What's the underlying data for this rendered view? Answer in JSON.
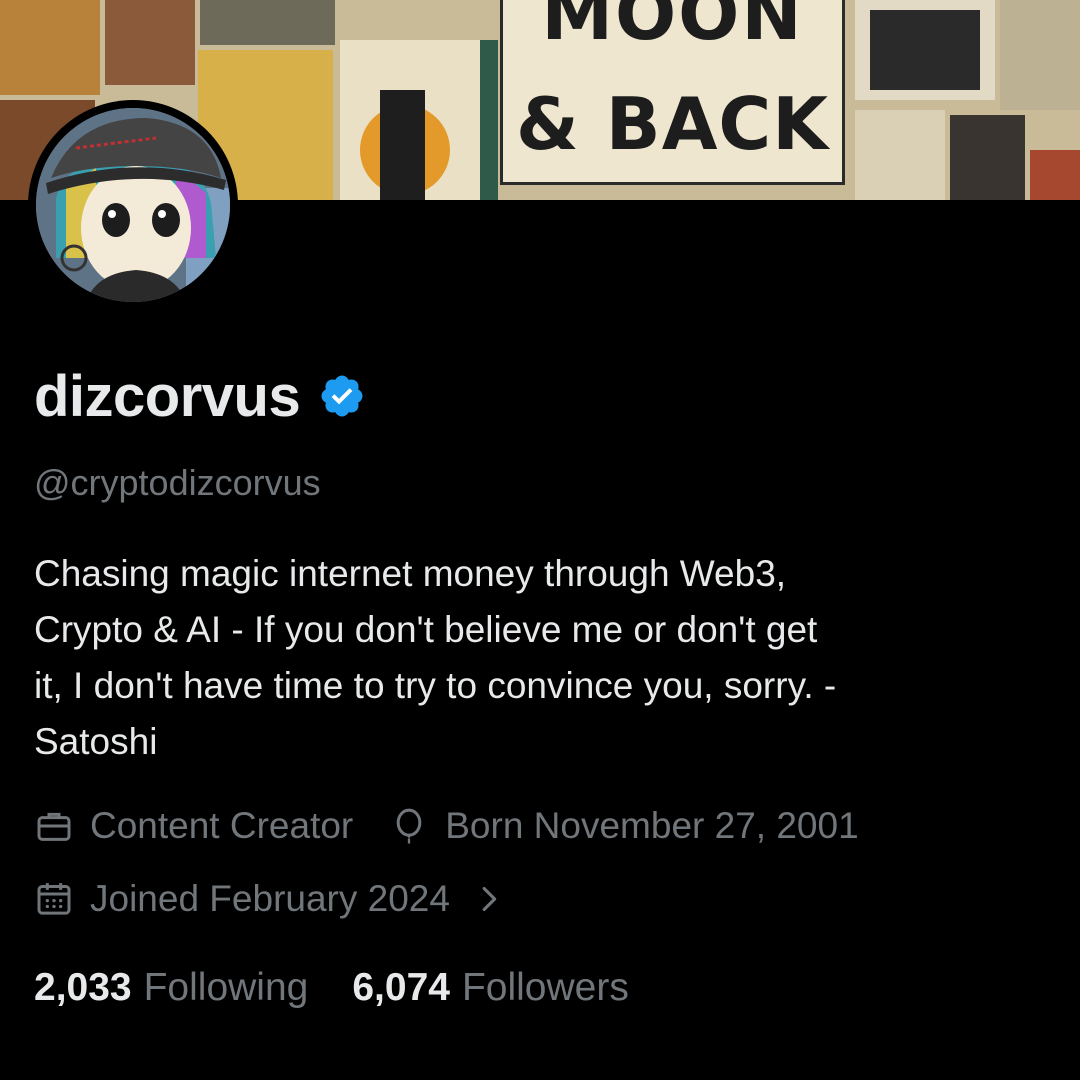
{
  "banner": {
    "line1": "MOON",
    "line2": "& BACK"
  },
  "profile": {
    "display_name": "dizcorvus",
    "handle": "@cryptodizcorvus",
    "verified_color": "#1d9bf0",
    "bio_lines": [
      "Chasing magic internet money through Web3,",
      "Crypto & AI  - If you don't believe me or don't get",
      "it, I don't have time to try to convince you, sorry. -",
      "Satoshi"
    ],
    "profession": "Content Creator",
    "birthday": "Born November 27, 2001",
    "joined": "Joined February 2024"
  },
  "stats": {
    "following_count": "2,033",
    "following_label": "Following",
    "followers_count": "6,074",
    "followers_label": "Followers"
  },
  "icons": {
    "profession": "briefcase-icon",
    "birthday": "balloon-icon",
    "joined": "calendar-icon",
    "more": "chevron-right-icon",
    "verified": "verified-badge-icon"
  }
}
